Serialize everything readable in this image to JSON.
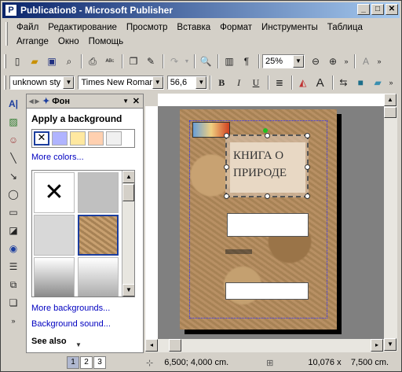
{
  "window": {
    "title": "Publication8 - Microsoft Publisher",
    "minimize": "_",
    "maximize": "□",
    "close": "✕"
  },
  "menu": {
    "row1": [
      "Файл",
      "Редактирование",
      "Просмотр",
      "Вставка",
      "Формат",
      "Инструменты",
      "Таблица"
    ],
    "row2": [
      "Arrange",
      "Окно",
      "Помощь"
    ]
  },
  "toolbar": {
    "zoom": "25%",
    "style": "unknown sty",
    "font": "Times New Roman",
    "size": "56,6",
    "bold": "B",
    "italic": "I",
    "underline": "U"
  },
  "task_pane": {
    "title": "Фон",
    "heading": "Apply a background",
    "more_colors": "More colors...",
    "more_backgrounds": "More backgrounds...",
    "background_sound": "Background sound...",
    "see_also": "See also",
    "swatch_colors": [
      "#b0b4ff",
      "#ffe8a0",
      "#ffd0b0",
      "#f0f0f0"
    ]
  },
  "document": {
    "heading_line1": "КНИГА О",
    "heading_line2": "ПРИРОДЕ"
  },
  "status": {
    "pages": [
      "1",
      "2",
      "3"
    ],
    "position": "6,500; 4,000 cm.",
    "size": "10,076 x    7,500 cm."
  }
}
